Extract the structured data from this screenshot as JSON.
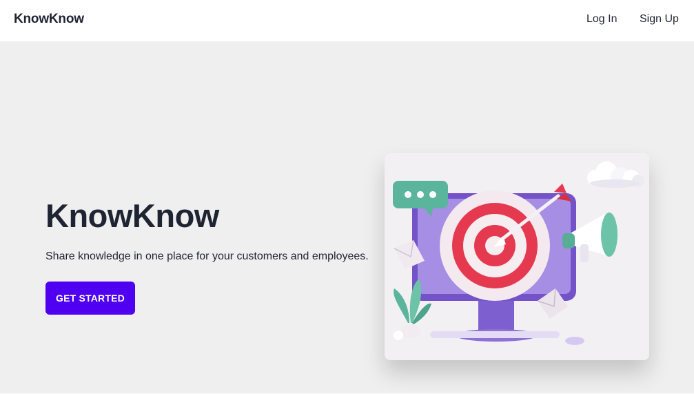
{
  "header": {
    "brand": "KnowKnow",
    "nav": {
      "login": "Log In",
      "signup": "Sign Up"
    }
  },
  "hero": {
    "title": "KnowKnow",
    "subtitle": "Share knowledge in one place for your customers and employees.",
    "cta_label": "GET STARTED"
  },
  "illustration": {
    "description_icons": [
      "target-icon",
      "arrow-icon",
      "chat-bubble-icon",
      "megaphone-icon",
      "cloud-icon",
      "envelope-icon",
      "plant-icon",
      "monitor-icon",
      "keyboard-icon",
      "mouse-icon"
    ]
  },
  "colors": {
    "accent": "#4f00f0",
    "background": "#efefef",
    "header": "#ffffff",
    "text": "#1f2433",
    "monitor": "#8e70d8",
    "target_red": "#e5394f"
  }
}
